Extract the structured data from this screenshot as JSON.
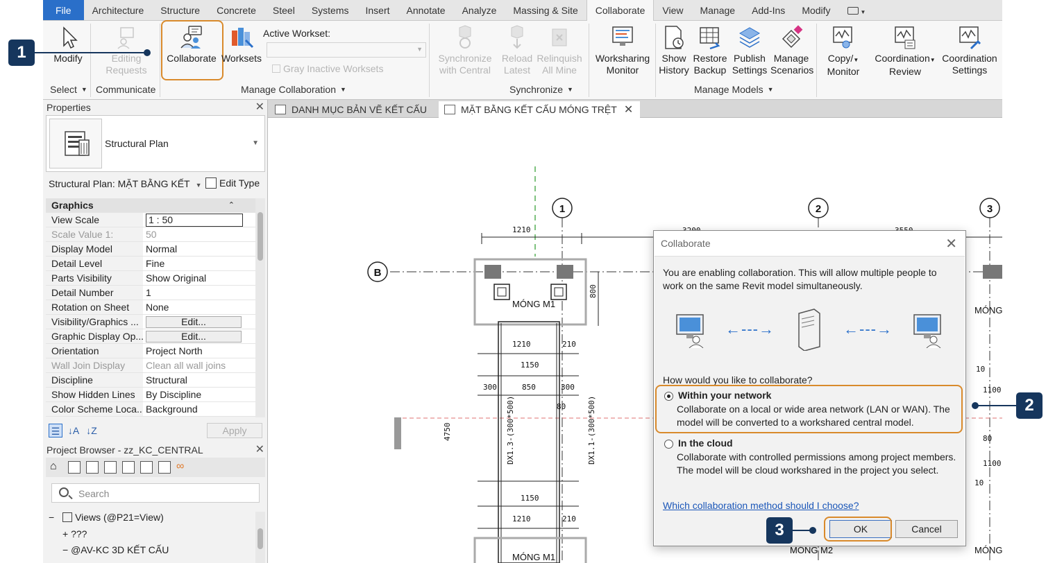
{
  "ribbon": {
    "tabs": [
      "File",
      "Architecture",
      "Structure",
      "Concrete",
      "Steel",
      "Systems",
      "Insert",
      "Annotate",
      "Analyze",
      "Massing & Site",
      "Collaborate",
      "View",
      "Manage",
      "Add-Ins",
      "Modify"
    ],
    "active_tab": "Collaborate",
    "buttons": {
      "modify": "Modify",
      "editing_requests_1": "Editing",
      "editing_requests_2": "Requests",
      "collaborate": "Collaborate",
      "worksets": "Worksets",
      "active_workset_label": "Active Workset:",
      "gray_inactive": "Gray Inactive Worksets",
      "sync_1": "Synchronize",
      "sync_2": "with Central",
      "reload_1": "Reload",
      "reload_2": "Latest",
      "relinquish_1": "Relinquish",
      "relinquish_2": "All Mine",
      "worksharing_1": "Worksharing",
      "worksharing_2": "Monitor",
      "show_history_1": "Show",
      "show_history_2": "History",
      "restore_backup_1": "Restore",
      "restore_backup_2": "Backup",
      "publish_settings_1": "Publish",
      "publish_settings_2": "Settings",
      "manage_scenarios_1": "Manage",
      "manage_scenarios_2": "Scenarios",
      "copy_monitor_1": "Copy/",
      "copy_monitor_2": "Monitor",
      "coord_review_1": "Coordination",
      "coord_review_2": "Review",
      "coord_settings_1": "Coordination",
      "coord_settings_2": "Settings"
    },
    "groups": {
      "select": "Select",
      "communicate": "Communicate",
      "manage_collaboration": "Manage Collaboration",
      "synchronize": "Synchronize",
      "manage_models": "Manage Models"
    }
  },
  "callouts": {
    "one": "1",
    "two": "2",
    "three": "3"
  },
  "properties": {
    "title": "Properties",
    "type_name": "Structural Plan",
    "instance": "Structural Plan: MẶT BẰNG KẾT",
    "edit_type": "Edit Type",
    "group_graphics": "Graphics",
    "rows": [
      {
        "k": "View Scale",
        "v": "1 : 50"
      },
      {
        "k": "Scale Value    1:",
        "v": "50"
      },
      {
        "k": "Display Model",
        "v": "Normal"
      },
      {
        "k": "Detail Level",
        "v": "Fine"
      },
      {
        "k": "Parts Visibility",
        "v": "Show Original"
      },
      {
        "k": "Detail Number",
        "v": "1"
      },
      {
        "k": "Rotation on Sheet",
        "v": "None"
      },
      {
        "k": "Visibility/Graphics ...",
        "v": "Edit..."
      },
      {
        "k": "Graphic Display Op...",
        "v": "Edit..."
      },
      {
        "k": "Orientation",
        "v": "Project North"
      },
      {
        "k": "Wall Join Display",
        "v": "Clean all wall joins"
      },
      {
        "k": "Discipline",
        "v": "Structural"
      },
      {
        "k": "Show Hidden Lines",
        "v": "By Discipline"
      },
      {
        "k": "Color Scheme Loca...",
        "v": "Background"
      }
    ],
    "apply": "Apply"
  },
  "browser": {
    "title": "Project Browser - zz_KC_CENTRAL",
    "search_placeholder": "Search",
    "views": "Views (@P21=View)",
    "node1": "???",
    "node2": "@AV-KC 3D KẾT CẤU"
  },
  "view_tabs": {
    "tab1": "DANH MỤC BẢN VẼ KẾT CẤU",
    "tab2": "MẶT BẰNG KẾT CẤU MÓNG TRỆT"
  },
  "drawing": {
    "grid1": "1",
    "grid2": "2",
    "grid3": "3",
    "gridB": "B",
    "mong_m1": "MÓNG M1",
    "mong_m2": "MÓNG M2",
    "mong_1": "MÓNG I",
    "dim_1210": "1210",
    "dim_3200": "3200",
    "dim_3550": "3550",
    "dim_800": "800",
    "dim_210": "210",
    "dim_150": "1150",
    "dim_300": "300",
    "dim_850": "850",
    "dim_80": "80",
    "dim_4750": "4750",
    "dx_13": "DX1.3-(300*500)",
    "dx_11": "DX1.1-(300*500)",
    "dim_10": "10",
    "dim_100": "1100",
    "dim_802": "80"
  },
  "dialog": {
    "title": "Collaborate",
    "desc": "You are enabling collaboration. This will allow multiple people to work on the same Revit model simultaneously.",
    "question": "How would you like to collaborate?",
    "opt1_title": "Within your network",
    "opt1_desc": "Collaborate on a local or wide area network (LAN or WAN). The model will be converted to a workshared central model.",
    "opt2_title": "In the cloud",
    "opt2_desc": "Collaborate with controlled permissions among project members. The model will be cloud workshared in the project you select.",
    "link": "Which collaboration method should I choose?",
    "ok": "OK",
    "cancel": "Cancel"
  },
  "colors": {
    "accent": "#2a6fc9",
    "highlight": "#d98a2b",
    "callout": "#16365d"
  }
}
